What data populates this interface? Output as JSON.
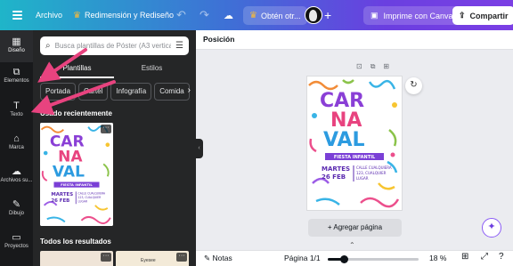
{
  "topbar": {
    "archivo": "Archivo",
    "title": "Redimensión y Rediseño",
    "doc_label": "Obtén otr...",
    "print_label": "Imprime con Canva",
    "share_label": "Compartir"
  },
  "rail": {
    "items": [
      {
        "label": "Diseño",
        "icon": "layout-icon"
      },
      {
        "label": "Elementos",
        "icon": "shapes-icon"
      },
      {
        "label": "Texto",
        "icon": "text-icon"
      },
      {
        "label": "Marca",
        "icon": "brand-icon"
      },
      {
        "label": "Archivos su...",
        "icon": "upload-icon"
      },
      {
        "label": "Dibujo",
        "icon": "draw-icon"
      },
      {
        "label": "Proyectos",
        "icon": "folder-icon"
      }
    ]
  },
  "panel": {
    "search_placeholder": "Busca plantillas de Póster (A3 vertical",
    "tabs": [
      "Plantillas",
      "Estilos"
    ],
    "chips": [
      "Portada",
      "Cartel",
      "Infografía",
      "Comida"
    ],
    "recent_title": "Usado recientemente",
    "results_title": "Todos los resultados"
  },
  "template": {
    "line1": "CAR",
    "line2": "NA",
    "line3": "VAL",
    "banner": "FIESTA INFANTIL",
    "date_top": "MARTES",
    "date_bottom": "26 FEB",
    "addr1": "CALLE CUALQUIERA",
    "addr2": "123, CUALQUIER",
    "addr3": "LUGAR"
  },
  "results": {
    "b_label": "Eyesee"
  },
  "canvas": {
    "context_label": "Posición",
    "add_page": "+ Agregar página"
  },
  "bottombar": {
    "notes": "Notas",
    "page_count": "Página 1/1",
    "zoom_label": "18 %",
    "zoom_fraction": 0.18
  },
  "colors": {
    "arrow": "#e8437f",
    "accent": "#7b3fe4"
  }
}
